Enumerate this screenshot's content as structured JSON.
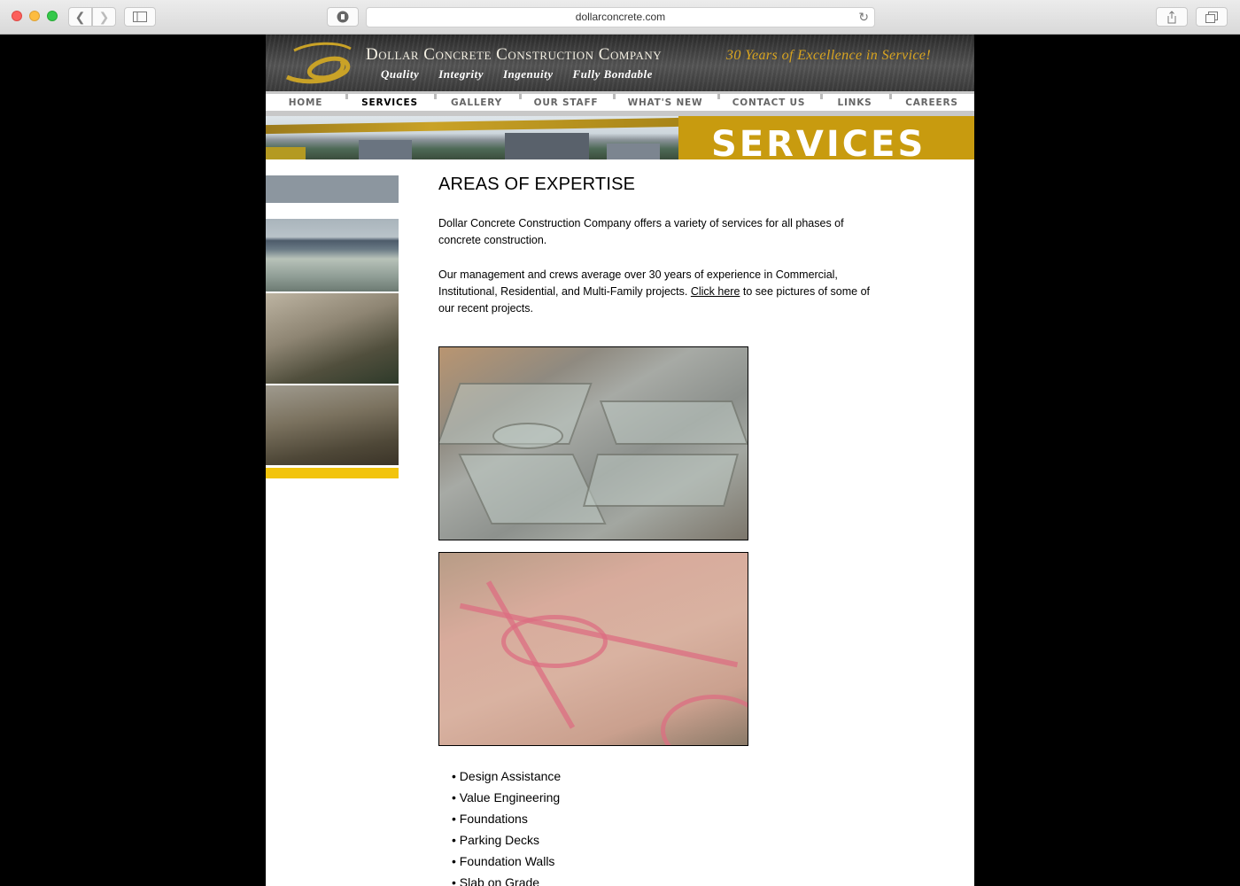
{
  "browser": {
    "url": "dollarconcrete.com",
    "icons": {
      "back": "chevron-left-icon",
      "forward": "chevron-right-icon",
      "sidebar": "sidebar-icon",
      "shield": "shield-icon",
      "reload": "reload-icon",
      "share": "share-icon",
      "tabs": "tabs-icon"
    }
  },
  "header": {
    "company": "Dollar Concrete Construction Company",
    "values": [
      "Quality",
      "Integrity",
      "Ingenuity",
      "Fully Bondable"
    ],
    "tagline": "30 Years of Excellence in Service!"
  },
  "nav": {
    "items": [
      {
        "label": "HOME"
      },
      {
        "label": "SERVICES",
        "active": true
      },
      {
        "label": "GALLERY"
      },
      {
        "label": "OUR STAFF"
      },
      {
        "label": "WHAT'S NEW"
      },
      {
        "label": "CONTACT US"
      },
      {
        "label": "LINKS"
      },
      {
        "label": "CAREERS"
      }
    ]
  },
  "banner": {
    "title": "SERVICES"
  },
  "main": {
    "heading": "AREAS OF EXPERTISE",
    "intro": "Dollar Concrete Construction Company offers a variety of services for all phases of concrete construction.",
    "experience_before": "Our management and crews average over 30 years of experience in Commercial, Institutional, Residential, and Multi-Family projects. ",
    "experience_link": "Click here",
    "experience_after": " to see pictures of some of our recent projects.",
    "services": [
      "• Design Assistance",
      "• Value Engineering",
      "• Foundations",
      "• Parking Decks",
      "• Foundation Walls",
      "• Slab on Grade"
    ]
  },
  "colors": {
    "accent_gold": "#c89b0f",
    "sidebar_yellow": "#f2c40c",
    "sidebar_grey": "#8c969f"
  }
}
